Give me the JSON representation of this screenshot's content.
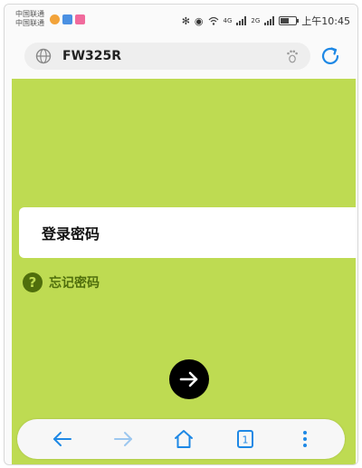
{
  "status_bar": {
    "carrier_line1": "中国联通",
    "carrier_line2": "中国联通",
    "sig1": "4G",
    "sig2": "2G",
    "time": "上午10:45"
  },
  "browser": {
    "url": "FW325R"
  },
  "page": {
    "password_label": "登录密码",
    "forgot_label": "忘记密码",
    "help_glyph": "?"
  },
  "colors": {
    "page_bg": "#bedb52",
    "accent_dark": "#4f6e0c",
    "browser_blue": "#1e88e5"
  },
  "nav": {
    "tab_count": "1",
    "icons": [
      "back-icon",
      "forward-icon",
      "home-icon",
      "tabs-icon",
      "menu-icon"
    ]
  }
}
